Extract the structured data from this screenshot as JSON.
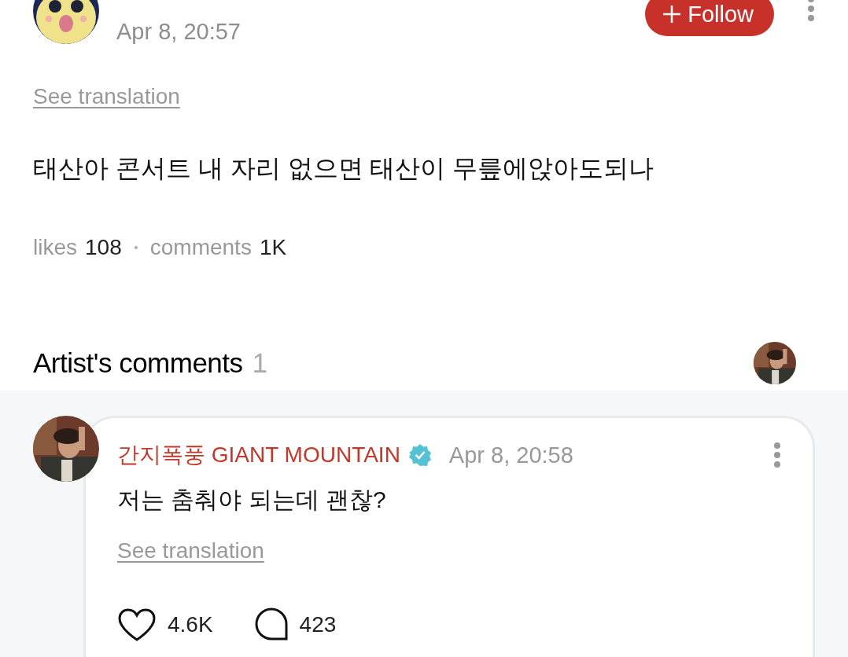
{
  "post": {
    "date": "Apr 8, 20:57",
    "follow_button": "Follow",
    "see_translation": "See translation",
    "text": "태산아 콘서트 내 자리 없으면 태산이 무릎에앉아도되나",
    "likes_label": "likes",
    "likes": "108",
    "comments_label": "comments",
    "comments": "1K"
  },
  "artist_comments": {
    "title": "Artist's comments",
    "count": "1",
    "comments": [
      {
        "author": "간지폭풍 GIANT MOUNTAIN",
        "verified": true,
        "date": "Apr 8, 20:58",
        "text": "저는 춤춰야 되는데 괜찮?",
        "see_translation": "See translation",
        "likes": "4.6K",
        "replies": "423"
      }
    ]
  }
}
